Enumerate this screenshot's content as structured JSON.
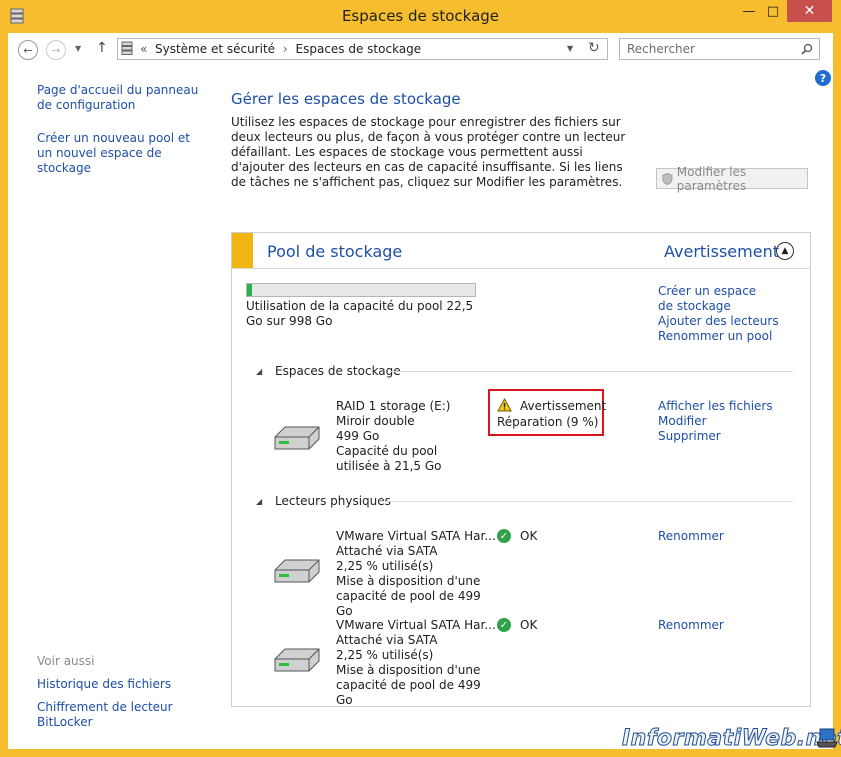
{
  "window": {
    "title": "Espaces de stockage",
    "minimize": "—",
    "maximize": "□",
    "close": "✕"
  },
  "address_bar": {
    "prefix": "«",
    "breadcrumb_1": "Système et sécurité",
    "separator": "›",
    "breadcrumb_2": "Espaces de stockage"
  },
  "search": {
    "placeholder": "Rechercher"
  },
  "sidebar": {
    "link_1": "Page d'accueil du panneau de configuration",
    "link_2": "Créer un nouveau pool et un nouvel espace de stockage",
    "see_also": "Voir aussi",
    "link_3": "Historique des fichiers",
    "link_4": "Chiffrement de lecteur BitLocker"
  },
  "main": {
    "heading": "Gérer les espaces de stockage",
    "description": "Utilisez les espaces de stockage pour enregistrer des fichiers sur deux lecteurs ou plus, de façon à vous protéger contre un lecteur défaillant. Les espaces de stockage vous permettent aussi d'ajouter des lecteurs en cas de capacité insuffisante. Si les liens de tâches ne s'affichent pas, cliquez sur Modifier les paramètres.",
    "modify_button": "Modifier les paramètres"
  },
  "pool": {
    "title": "Pool de stockage",
    "status": "Avertissement",
    "usage_fraction": 0.0225,
    "usage_text": "Utilisation de la capacité du pool 22,5 Go sur 998 Go",
    "actions": [
      "Créer un espace de stockage",
      "Ajouter des lecteurs",
      "Renommer un pool"
    ],
    "spaces_label": "Espaces de stockage",
    "space": {
      "name": "RAID 1 storage (E:)",
      "type": "Miroir double",
      "size": "499 Go",
      "pool_used": "Capacité du pool utilisée à 21,5 Go",
      "status": "Avertissement",
      "repair": "Réparation (9 %)",
      "actions": [
        "Afficher les fichiers",
        "Modifier",
        "Supprimer"
      ]
    },
    "drives_label": "Lecteurs physiques",
    "drives": [
      {
        "name": "VMware Virtual SATA Har...",
        "attach": "Attaché via SATA",
        "used": "2,25 % utilisé(s)",
        "provide": "Mise à disposition d'une capacité de pool de 499 Go",
        "status": "OK",
        "action": "Renommer"
      },
      {
        "name": "VMware Virtual SATA Har...",
        "attach": "Attaché via SATA",
        "used": "2,25 % utilisé(s)",
        "provide": "Mise à disposition d'une capacité de pool de 499 Go",
        "status": "OK",
        "action": "Renommer"
      }
    ]
  },
  "watermark": "InformatiWeb.net",
  "colors": {
    "link": "#1e4fa6",
    "frame": "#f6be2e",
    "pool_stripe": "#f2b613",
    "warning_border": "#d9151d",
    "ok": "#2fa24b",
    "close_btn": "#c7504c"
  }
}
